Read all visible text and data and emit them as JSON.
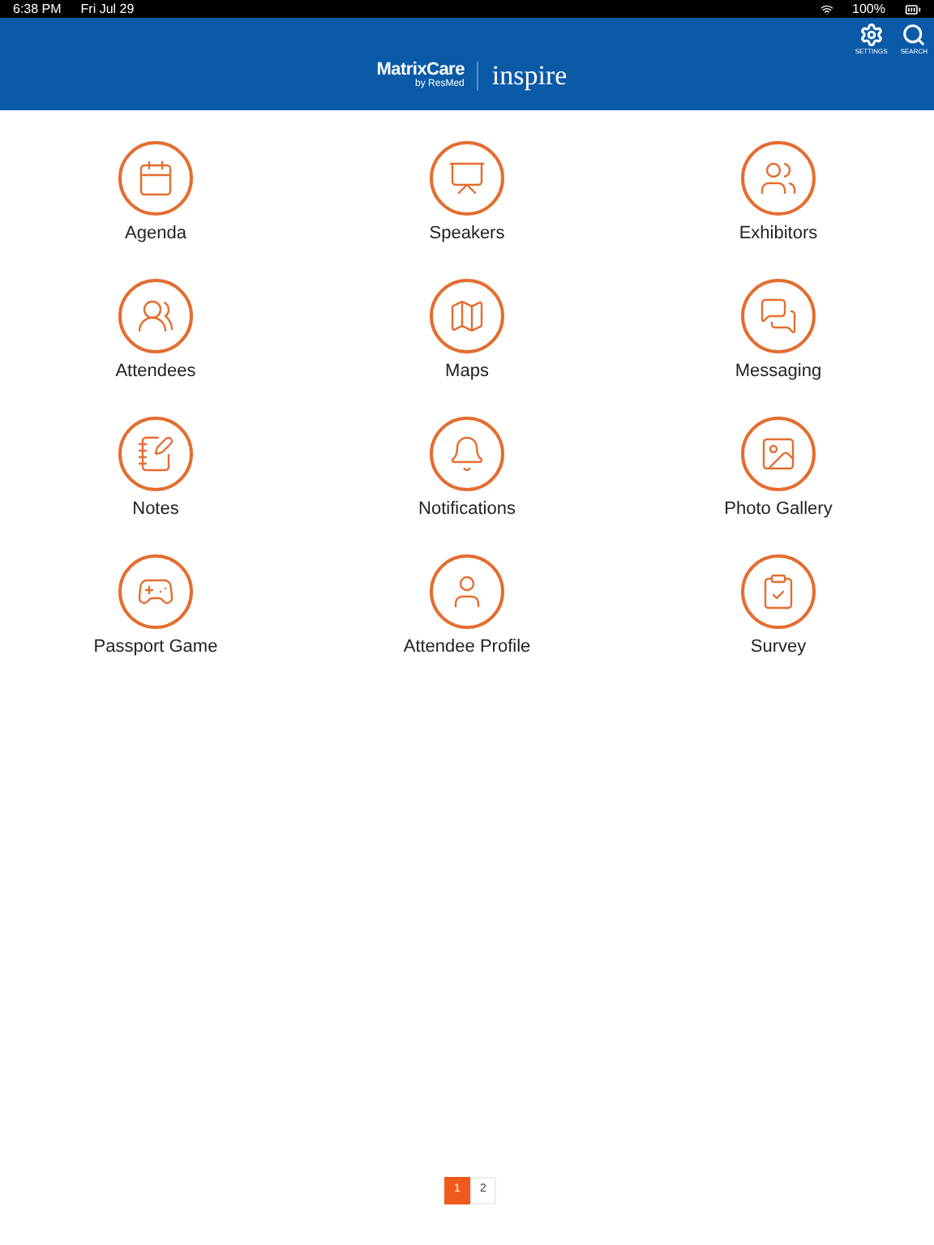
{
  "status_bar": {
    "time": "6:38 PM",
    "date": "Fri Jul 29",
    "battery": "100%"
  },
  "header": {
    "actions": [
      {
        "kind": "settings",
        "label": "SETTINGS"
      },
      {
        "kind": "search",
        "label": "SEARCH"
      }
    ],
    "logo": {
      "brand": "MatrixCare",
      "byline": "by ResMed",
      "event": "inspire"
    }
  },
  "tiles": [
    {
      "kind": "calendar",
      "label": "Agenda"
    },
    {
      "kind": "speaker",
      "label": "Speakers"
    },
    {
      "kind": "group",
      "label": "Exhibitors"
    },
    {
      "kind": "crowd",
      "label": "Attendees"
    },
    {
      "kind": "map",
      "label": "Maps"
    },
    {
      "kind": "chat",
      "label": "Messaging"
    },
    {
      "kind": "notes",
      "label": "Notes"
    },
    {
      "kind": "bell",
      "label": "Notifications"
    },
    {
      "kind": "image",
      "label": "Photo Gallery"
    },
    {
      "kind": "gamepad",
      "label": "Passport Game"
    },
    {
      "kind": "user",
      "label": "Attendee Profile"
    },
    {
      "kind": "clipboard",
      "label": "Survey"
    }
  ],
  "pagination": [
    {
      "label": "1",
      "selected": true
    },
    {
      "label": "2",
      "selected": false
    }
  ]
}
